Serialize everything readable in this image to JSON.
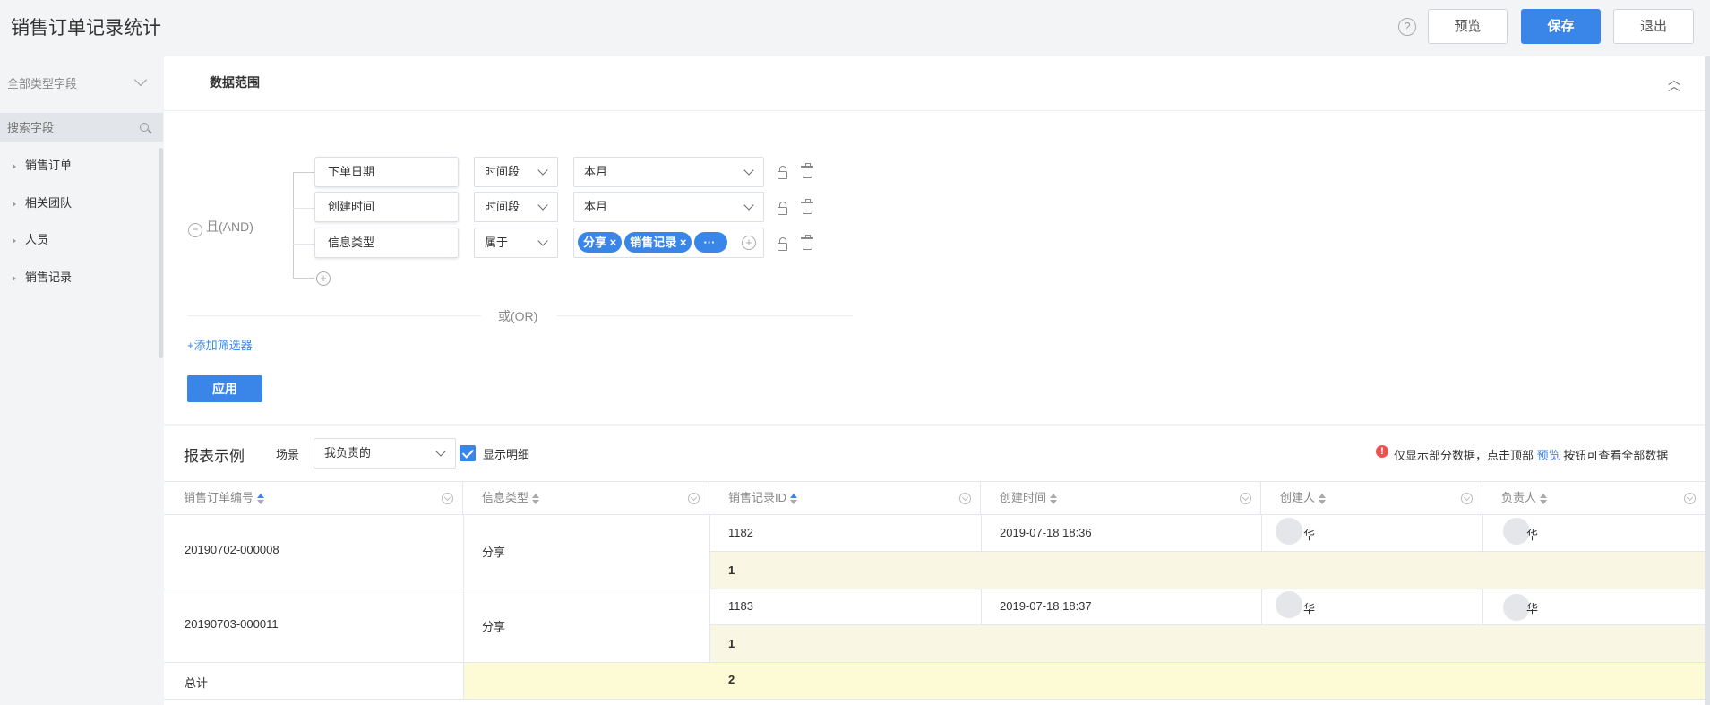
{
  "header": {
    "title": "销售订单记录统计",
    "help": "?",
    "preview_label": "预览",
    "save_label": "保存",
    "exit_label": "退出"
  },
  "sidebar": {
    "type_filter": "全部类型字段",
    "search_placeholder": "搜索字段",
    "items": [
      {
        "label": "销售订单"
      },
      {
        "label": "相关团队"
      },
      {
        "label": "人员"
      },
      {
        "label": "销售记录"
      }
    ]
  },
  "data_range": {
    "title": "数据范围",
    "and_label": "且(AND)",
    "conditions": [
      {
        "field": "下单日期",
        "operator": "时间段",
        "value": "本月"
      },
      {
        "field": "创建时间",
        "operator": "时间段",
        "value": "本月"
      },
      {
        "field": "信息类型",
        "operator": "属于",
        "tags": [
          "分享",
          "销售记录"
        ],
        "more": "···"
      }
    ],
    "or_label": "或(OR)",
    "add_filter": "+添加筛选器",
    "apply_label": "应用"
  },
  "report": {
    "title": "报表示例",
    "scene_label": "场景",
    "scene_value": "我负责的",
    "show_detail_label": "显示明细",
    "notice_prefix": "仅显示部分数据，点击顶部",
    "notice_link": "预览",
    "notice_suffix": "按钮可查看全部数据",
    "columns": [
      "销售订单编号",
      "信息类型",
      "销售记录ID",
      "创建时间",
      "创建人",
      "负责人"
    ],
    "rows": [
      {
        "order_no": "20190702-000008",
        "info_type": "分享",
        "record_id": "1182",
        "created": "2019-07-18 18:36",
        "creator": "华",
        "owner": "华",
        "subtotal": "1"
      },
      {
        "order_no": "20190703-000011",
        "info_type": "分享",
        "record_id": "1183",
        "created": "2019-07-18 18:37",
        "creator": "华",
        "owner": "华",
        "subtotal": "1"
      }
    ],
    "total_label": "总计",
    "total_value": "2"
  }
}
